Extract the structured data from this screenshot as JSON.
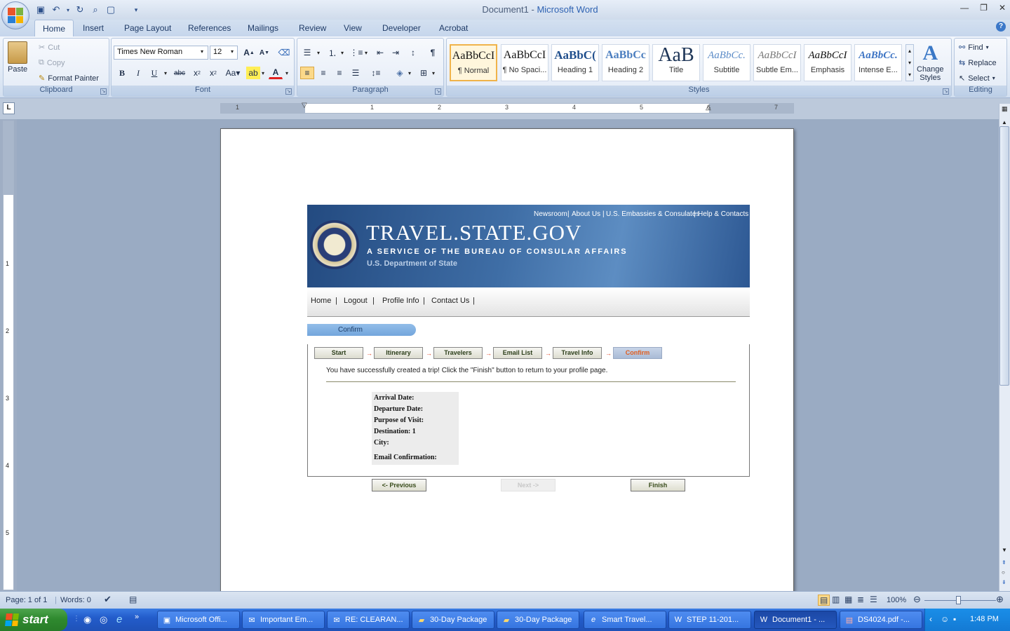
{
  "window": {
    "doc_name": "Document1",
    "separator": " - ",
    "app_name": "Microsoft Word"
  },
  "tabs": [
    "Home",
    "Insert",
    "Page Layout",
    "References",
    "Mailings",
    "Review",
    "View",
    "Developer",
    "Acrobat"
  ],
  "clipboard": {
    "paste": "Paste",
    "cut": "Cut",
    "copy": "Copy",
    "format_painter": "Format Painter",
    "label": "Clipboard"
  },
  "font": {
    "name": "Times New Roman",
    "size": "12",
    "label": "Font"
  },
  "paragraph": {
    "label": "Paragraph"
  },
  "styles": {
    "label": "Styles",
    "items": [
      {
        "sample": "AaBbCcI",
        "name": "¶ Normal"
      },
      {
        "sample": "AaBbCcI",
        "name": "¶ No Spaci..."
      },
      {
        "sample": "AaBbC(",
        "name": "Heading 1"
      },
      {
        "sample": "AaBbCc",
        "name": "Heading 2"
      },
      {
        "sample": "AaB",
        "name": "Title"
      },
      {
        "sample": "AaBbCc.",
        "name": "Subtitle"
      },
      {
        "sample": "AaBbCcI",
        "name": "Subtle Em..."
      },
      {
        "sample": "AaBbCcI",
        "name": "Emphasis"
      },
      {
        "sample": "AaBbCc.",
        "name": "Intense E..."
      }
    ],
    "change_styles_1": "Change",
    "change_styles_2": "Styles"
  },
  "editing": {
    "find": "Find",
    "replace": "Replace",
    "select": "Select",
    "label": "Editing"
  },
  "ruler_numbers": [
    "1",
    "1",
    "2",
    "3",
    "4",
    "5",
    "6",
    "7"
  ],
  "vruler_numbers": [
    "1",
    "2",
    "3",
    "4",
    "5"
  ],
  "site": {
    "top_links": [
      "Newsroom",
      "About Us",
      "U.S. Embassies & Consulates",
      "Help & Contacts"
    ],
    "title": "TRAVEL.STATE.GOV",
    "subtitle": "A SERVICE OF THE BUREAU OF CONSULAR AFFAIRS",
    "dept": "U.S. Department of State",
    "nav": [
      "Home",
      "Logout",
      "Profile Info",
      "Contact Us"
    ],
    "confirm_tab": "Confirm",
    "steps": [
      "Start",
      "Itinerary",
      "Travelers",
      "Email List",
      "Travel Info",
      "Confirm"
    ],
    "success_msg": "You have successfully created a trip! Click the \"Finish\" button to return to your profile page.",
    "details": [
      "Arrival Date:",
      "Departure Date:",
      "Purpose of Visit:",
      "Destination: 1",
      "City:",
      "Email Confirmation:"
    ],
    "btn_prev": "<- Previous",
    "btn_next": "Next ->",
    "btn_finish": "Finish"
  },
  "status": {
    "page": "Page: 1 of 1",
    "words": "Words: 0",
    "zoom": "100%"
  },
  "taskbar": {
    "start": "start",
    "tasks": [
      "Microsoft Offi...",
      "Important Em...",
      "RE: CLEARAN...",
      "30-Day Package",
      "30-Day Package",
      "Smart Travel...",
      "STEP 11-201...",
      "Document1 - ...",
      "DS4024.pdf -..."
    ],
    "clock": "1:48 PM"
  },
  "colors": {
    "accent": "#2e62b2",
    "banner": "#2d5893",
    "active_step": "#e05d1e"
  }
}
